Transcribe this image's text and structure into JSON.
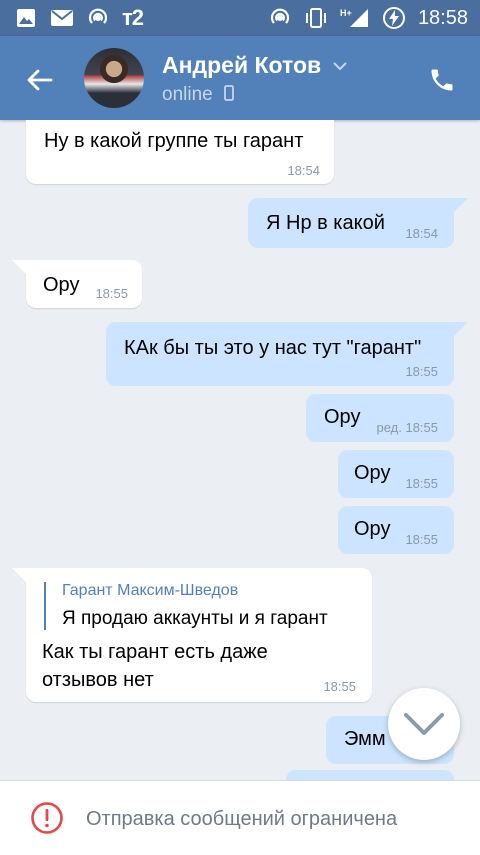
{
  "status_bar": {
    "carrier": "т2",
    "network": "H+",
    "time": "18:58",
    "icons": [
      "image-icon",
      "mail-icon",
      "hotspot-icon",
      "hotspot-icon",
      "vibrate-icon",
      "signal-icon",
      "battery-charging-icon"
    ]
  },
  "header": {
    "name": "Андрей Котов",
    "status": "online",
    "accent": "#5181b8"
  },
  "messages": [
    {
      "dir": "in",
      "text": "Ну в какой группе ты гарант",
      "time": "18:54"
    },
    {
      "dir": "out",
      "text": "Я Нр в какой",
      "time": "18:54"
    },
    {
      "dir": "in",
      "text": "Ору",
      "time": "18:55"
    },
    {
      "dir": "out",
      "text": "КАк бы ты это у нас тут \"гарант\"",
      "time": "18:55"
    },
    {
      "dir": "out",
      "text": "Ору",
      "time": "ред. 18:55"
    },
    {
      "dir": "out",
      "text": "Ору",
      "time": "18:55"
    },
    {
      "dir": "out",
      "text": "Ору",
      "time": "18:55"
    },
    {
      "dir": "in",
      "reply_author": "Гарант Максим-Шведов",
      "reply_text": "Я продаю аккаунты и я гарант",
      "text_line1": "Как ты гарант есть даже",
      "text_line2": "отзывов нет",
      "time": "18:55"
    },
    {
      "dir": "out",
      "text": "Эмм"
    }
  ],
  "bottom": {
    "restriction_text": "Отправка сообщений ограничена"
  }
}
